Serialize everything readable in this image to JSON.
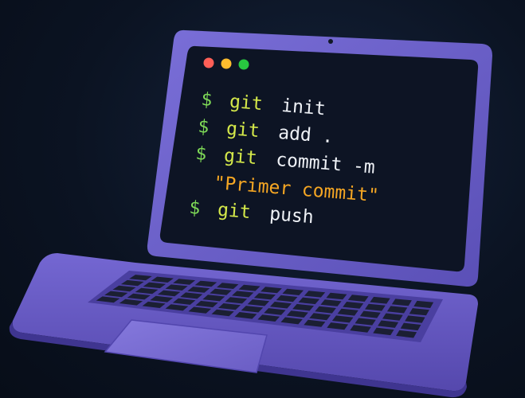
{
  "colors": {
    "background": "#0b1322",
    "laptop_body": "#6a5ec9",
    "screen_bg": "#0d1424",
    "prompt": "#7ed957",
    "command": "#d4e84a",
    "argument": "#eef1f6",
    "string": "#f5a623",
    "dot_red": "#ff5f57",
    "dot_yellow": "#febc2e",
    "dot_green": "#28c840"
  },
  "window_controls": [
    "close-dot",
    "minimize-dot",
    "maximize-dot"
  ],
  "terminal": {
    "lines": [
      {
        "prompt": "$",
        "command": "git",
        "args": "init",
        "string": ""
      },
      {
        "prompt": "$",
        "command": "git",
        "args": "add .",
        "string": ""
      },
      {
        "prompt": "$",
        "command": "git",
        "args": "commit -m",
        "string": ""
      },
      {
        "prompt": "",
        "command": "",
        "args": "",
        "string": "\"Primer commit\""
      },
      {
        "prompt": "$",
        "command": "git",
        "args": "push",
        "string": ""
      }
    ]
  }
}
